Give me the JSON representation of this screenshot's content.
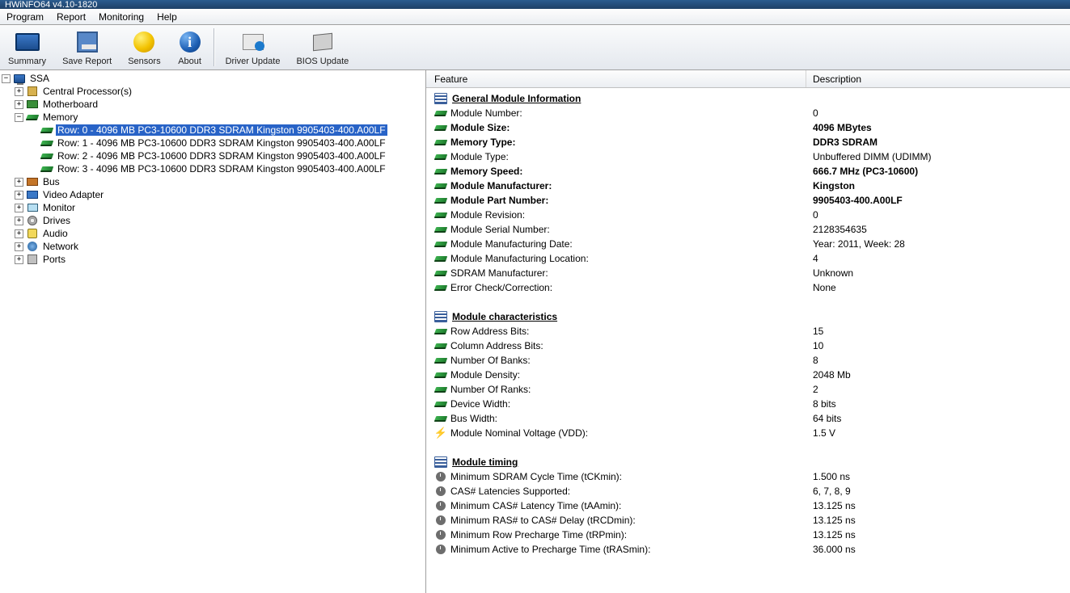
{
  "titlebar": "HWiNFO64 v4.10-1820",
  "menu": [
    "Program",
    "Report",
    "Monitoring",
    "Help"
  ],
  "toolbar": [
    {
      "id": "summary",
      "label": "Summary"
    },
    {
      "id": "save-report",
      "label": "Save Report"
    },
    {
      "id": "sensors",
      "label": "Sensors"
    },
    {
      "id": "about",
      "label": "About"
    },
    {
      "id": "driver-update",
      "label": "Driver Update"
    },
    {
      "id": "bios-update",
      "label": "BIOS Update"
    }
  ],
  "tree": {
    "root": "SSA",
    "nodes": [
      {
        "id": "cpu",
        "label": "Central Processor(s)",
        "icon": "chip",
        "expand": "plus"
      },
      {
        "id": "mb",
        "label": "Motherboard",
        "icon": "board",
        "expand": "plus"
      },
      {
        "id": "memory",
        "label": "Memory",
        "icon": "ram",
        "expand": "minus",
        "children": [
          {
            "id": "row0",
            "label": "Row: 0 - 4096 MB PC3-10600 DDR3 SDRAM Kingston 9905403-400.A00LF",
            "icon": "ram",
            "selected": true
          },
          {
            "id": "row1",
            "label": "Row: 1 - 4096 MB PC3-10600 DDR3 SDRAM Kingston 9905403-400.A00LF",
            "icon": "ram"
          },
          {
            "id": "row2",
            "label": "Row: 2 - 4096 MB PC3-10600 DDR3 SDRAM Kingston 9905403-400.A00LF",
            "icon": "ram"
          },
          {
            "id": "row3",
            "label": "Row: 3 - 4096 MB PC3-10600 DDR3 SDRAM Kingston 9905403-400.A00LF",
            "icon": "ram"
          }
        ]
      },
      {
        "id": "bus",
        "label": "Bus",
        "icon": "bus",
        "expand": "plus"
      },
      {
        "id": "video",
        "label": "Video Adapter",
        "icon": "video",
        "expand": "plus"
      },
      {
        "id": "monitor",
        "label": "Monitor",
        "icon": "monitor",
        "expand": "plus"
      },
      {
        "id": "drives",
        "label": "Drives",
        "icon": "drive",
        "expand": "plus"
      },
      {
        "id": "audio",
        "label": "Audio",
        "icon": "audio",
        "expand": "plus"
      },
      {
        "id": "network",
        "label": "Network",
        "icon": "net",
        "expand": "plus"
      },
      {
        "id": "ports",
        "label": "Ports",
        "icon": "port",
        "expand": "plus"
      }
    ]
  },
  "detail": {
    "header": {
      "col1": "Feature",
      "col2": "Description"
    },
    "groups": [
      {
        "title": "General Module Information",
        "rows": [
          {
            "icon": "ram",
            "name": "Module Number:",
            "value": "0"
          },
          {
            "icon": "ram",
            "name": "Module Size:",
            "value": "4096 MBytes",
            "bold": true
          },
          {
            "icon": "ram",
            "name": "Memory Type:",
            "value": "DDR3 SDRAM",
            "bold": true
          },
          {
            "icon": "ram",
            "name": "Module Type:",
            "value": "Unbuffered DIMM (UDIMM)"
          },
          {
            "icon": "ram",
            "name": "Memory Speed:",
            "value": "666.7 MHz (PC3-10600)",
            "bold": true
          },
          {
            "icon": "ram",
            "name": "Module Manufacturer:",
            "value": "Kingston",
            "bold": true
          },
          {
            "icon": "ram",
            "name": "Module Part Number:",
            "value": "9905403-400.A00LF",
            "bold": true
          },
          {
            "icon": "ram",
            "name": "Module Revision:",
            "value": "0"
          },
          {
            "icon": "ram",
            "name": "Module Serial Number:",
            "value": "2128354635"
          },
          {
            "icon": "ram",
            "name": "Module Manufacturing Date:",
            "value": "Year: 2011, Week: 28"
          },
          {
            "icon": "ram",
            "name": "Module Manufacturing Location:",
            "value": "4"
          },
          {
            "icon": "ram",
            "name": "SDRAM Manufacturer:",
            "value": "Unknown"
          },
          {
            "icon": "ram",
            "name": "Error Check/Correction:",
            "value": "None"
          }
        ]
      },
      {
        "title": "Module characteristics",
        "rows": [
          {
            "icon": "ram",
            "name": "Row Address Bits:",
            "value": "15"
          },
          {
            "icon": "ram",
            "name": "Column Address Bits:",
            "value": "10"
          },
          {
            "icon": "ram",
            "name": "Number Of Banks:",
            "value": "8"
          },
          {
            "icon": "ram",
            "name": "Module Density:",
            "value": "2048 Mb"
          },
          {
            "icon": "ram",
            "name": "Number Of Ranks:",
            "value": "2"
          },
          {
            "icon": "ram",
            "name": "Device Width:",
            "value": "8 bits"
          },
          {
            "icon": "ram",
            "name": "Bus Width:",
            "value": "64 bits"
          },
          {
            "icon": "bolt",
            "name": "Module Nominal Voltage (VDD):",
            "value": "1.5 V"
          }
        ]
      },
      {
        "title": "Module timing",
        "rows": [
          {
            "icon": "clock",
            "name": "Minimum SDRAM Cycle Time (tCKmin):",
            "value": "1.500 ns"
          },
          {
            "icon": "clock",
            "name": "CAS# Latencies Supported:",
            "value": "6, 7, 8, 9"
          },
          {
            "icon": "clock",
            "name": "Minimum CAS# Latency Time (tAAmin):",
            "value": "13.125 ns"
          },
          {
            "icon": "clock",
            "name": "Minimum RAS# to CAS# Delay (tRCDmin):",
            "value": "13.125 ns"
          },
          {
            "icon": "clock",
            "name": "Minimum Row Precharge Time (tRPmin):",
            "value": "13.125 ns"
          },
          {
            "icon": "clock",
            "name": "Minimum Active to Precharge Time (tRASmin):",
            "value": "36.000 ns"
          }
        ]
      }
    ]
  }
}
